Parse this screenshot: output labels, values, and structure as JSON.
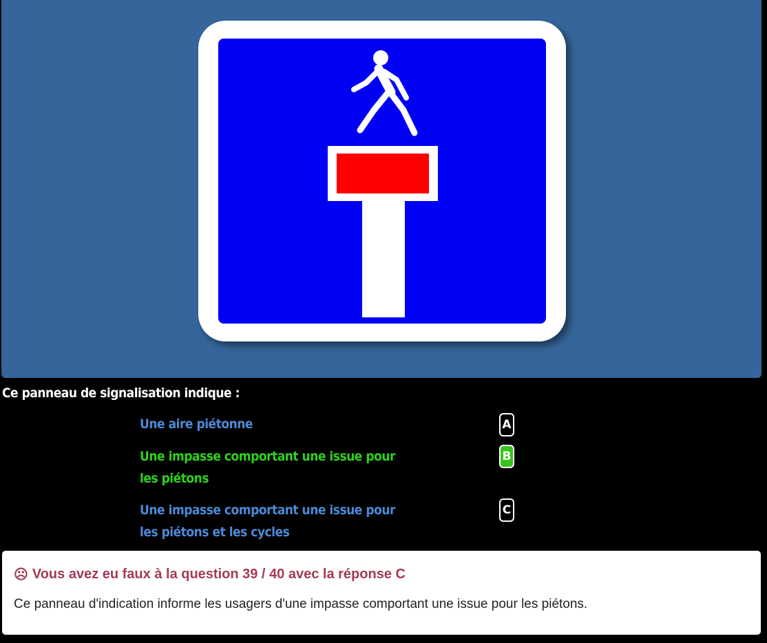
{
  "question": {
    "text": "Ce panneau de signalisation indique :"
  },
  "answers": [
    {
      "text": "Une aire piétonne",
      "key": "A",
      "state": "normal"
    },
    {
      "text": "Une impasse comportant une issue pour les piétons",
      "key": "B",
      "state": "correct"
    },
    {
      "text": "Une impasse comportant une issue pour les piétons et les cycles",
      "key": "C",
      "state": "normal"
    }
  ],
  "result": {
    "icon": "sad-face-icon",
    "title": "Vous avez eu faux à la question 39 / 40 avec la réponse C",
    "explanation": "Ce panneau d'indication informe les usagers d'une impasse comportant une issue pour les piétons."
  },
  "colors": {
    "panel_bg": "#35659a",
    "sign_blue": "#0000f5",
    "sign_red": "#ff0000",
    "answer_blue": "#4d8ad6",
    "answer_green": "#2cd31a",
    "error_title": "#a23a55"
  }
}
